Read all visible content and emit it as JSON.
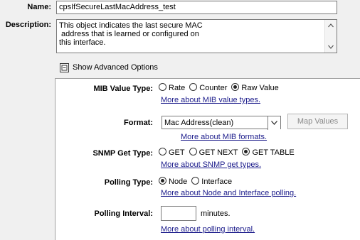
{
  "name": {
    "label": "Name:",
    "value": "cpsIfSecureLastMacAddress_test"
  },
  "description": {
    "label": "Description:",
    "lines": [
      "This object indicates the last secure MAC",
      " address that is learned or configured on",
      "this interface."
    ]
  },
  "advanced": {
    "label": "Show Advanced Options",
    "checked": true
  },
  "mib_value_type": {
    "label": "MIB Value Type:",
    "options": [
      "Rate",
      "Counter",
      "Raw Value"
    ],
    "selected": "Raw Value",
    "link": "More about MIB value types."
  },
  "format": {
    "label": "Format:",
    "selected": "Mac Address(clean)",
    "link": "More about MIB formats.",
    "map_values_button": "Map Values"
  },
  "snmp_get_type": {
    "label": "SNMP Get Type:",
    "options": [
      "GET",
      "GET NEXT",
      "GET TABLE"
    ],
    "selected": "GET TABLE",
    "link": "More about SNMP get types."
  },
  "polling_type": {
    "label": "Polling Type:",
    "options": [
      "Node",
      "Interface"
    ],
    "selected": "Node",
    "link": "More about Node and Interface polling."
  },
  "polling_interval": {
    "label": "Polling Interval:",
    "value": "",
    "unit": "minutes.",
    "link": "More about polling interval."
  }
}
